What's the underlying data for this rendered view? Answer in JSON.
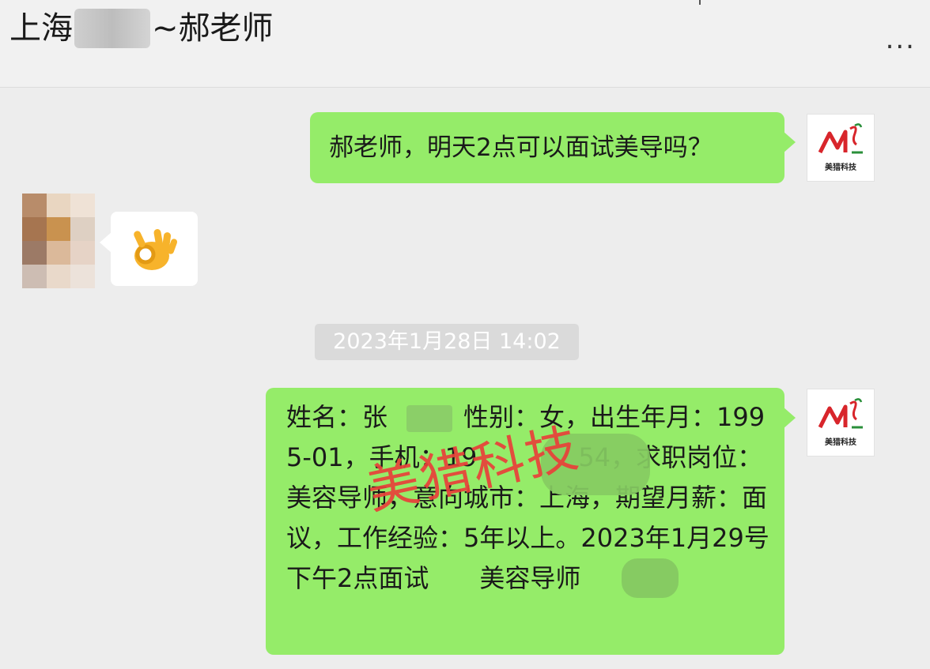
{
  "header": {
    "title_prefix": "上海",
    "title_suffix": "~郝老师",
    "more_label": "..."
  },
  "messages": [
    {
      "side": "right",
      "text": "郝老师，明天2点可以面试美导吗？"
    },
    {
      "side": "left",
      "type": "emoji",
      "emoji_name": "ok-hand-icon"
    },
    {
      "type": "timestamp",
      "text": "2023年1月28日 14:02"
    },
    {
      "side": "right",
      "text": "姓名：张　　，性别：女，出生年月：1995-01，手机：19　　　　54，求职岗位：美容导师，意向城市：上海，期望月薪：面议，工作经验：5年以上。2023年1月29号下午2点面试　　美容导师"
    }
  ],
  "avatar_me": {
    "brand": "美猎科技",
    "logo_text": "ML"
  },
  "watermark": "美猎科技",
  "colors": {
    "bubble_mine": "#95ec69",
    "bubble_other": "#ffffff",
    "background": "#ededed",
    "watermark": "#e8413a"
  }
}
